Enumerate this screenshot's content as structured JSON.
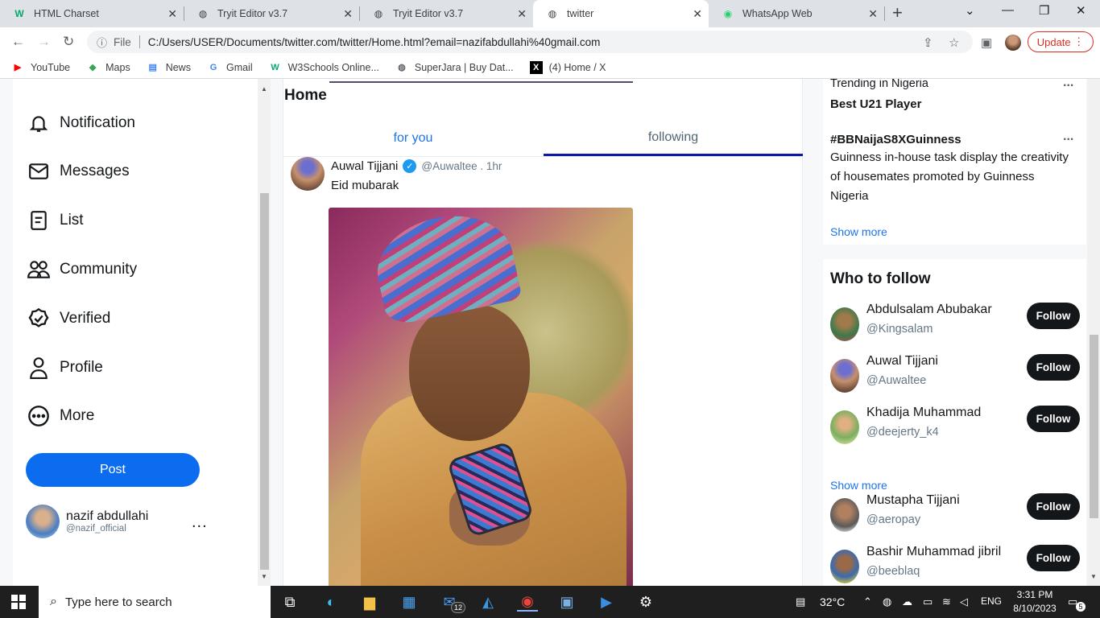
{
  "browser": {
    "tabs": [
      {
        "label": "HTML Charset",
        "icon": "w3schools-icon"
      },
      {
        "label": "Tryit Editor v3.7",
        "icon": "globe-icon"
      },
      {
        "label": "Tryit Editor v3.7",
        "icon": "globe-icon"
      },
      {
        "label": "twitter",
        "icon": "globe-icon",
        "active": true
      },
      {
        "label": "WhatsApp Web",
        "icon": "whatsapp-icon"
      }
    ],
    "address": {
      "scheme_label": "File",
      "url": "C:/Users/USER/Documents/twitter.com/twitter/Home.html?email=nazifabdullahi%40gmail.com"
    },
    "update_label": "Update",
    "bookmarks": [
      {
        "label": "YouTube",
        "icon": "youtube-icon",
        "color": "#ff0000"
      },
      {
        "label": "Maps",
        "icon": "maps-icon",
        "color": "#34a853"
      },
      {
        "label": "News",
        "icon": "news-icon",
        "color": "#4285f4"
      },
      {
        "label": "Gmail",
        "icon": "google-icon",
        "color": "#4285f4"
      },
      {
        "label": "W3Schools Online...",
        "icon": "w3schools-icon",
        "color": "#04aa6d"
      },
      {
        "label": "SuperJara | Buy Dat...",
        "icon": "globe-icon",
        "color": "#5f6368"
      },
      {
        "label": "(4) Home / X",
        "icon": "x-icon",
        "color": "#000000"
      }
    ]
  },
  "sidebar": {
    "items": [
      {
        "label": "Notification",
        "icon": "bell-icon"
      },
      {
        "label": "Messages",
        "icon": "mail-icon"
      },
      {
        "label": "List",
        "icon": "list-icon"
      },
      {
        "label": "Community",
        "icon": "community-icon"
      },
      {
        "label": "Verified",
        "icon": "verified-badge-icon"
      },
      {
        "label": "Profile",
        "icon": "user-icon"
      },
      {
        "label": "More",
        "icon": "more-circle-icon"
      }
    ],
    "post_label": "Post",
    "account": {
      "name": "nazif abdullahi",
      "handle": "@nazif_official",
      "menu": "..."
    }
  },
  "feed": {
    "title": "Home",
    "tabs": [
      {
        "label": "for you",
        "active": false
      },
      {
        "label": "following",
        "active": true
      }
    ],
    "tweet": {
      "author": "Auwal Tijjani",
      "handle_time": "@Auwaltee . 1hr",
      "text": "Eid mubarak"
    }
  },
  "trends": {
    "items": [
      {
        "meta": "Trending in Nigeria",
        "title": "Best U21 Player"
      },
      {
        "title": "#BBNaijaS8XGuinness",
        "description": "Guinness in-house task display the creativity of housemates promoted by Guinness Nigeria"
      }
    ],
    "menu": "...",
    "show_more": "Show more"
  },
  "who_to_follow": {
    "title": "Who to follow",
    "follow_label": "Follow",
    "show_more": "Show more",
    "accounts": [
      {
        "name": "Abdulsalam Abubakar",
        "handle": "@Kingsalam"
      },
      {
        "name": "Auwal Tijjani",
        "handle": "@Auwaltee"
      },
      {
        "name": "Khadija Muhammad",
        "handle": "@deejerty_k4"
      },
      {
        "name": "Mustapha Tijjani",
        "handle": "@aeropay"
      },
      {
        "name": "Bashir Muhammad jibril",
        "handle": "@beeblaq"
      }
    ]
  },
  "taskbar": {
    "search_placeholder": "Type here to search",
    "mail_badge": "12",
    "weather": "32°C",
    "language": "ENG",
    "time": "3:31 PM",
    "date": "8/10/2023",
    "notifications": "5"
  },
  "colors": {
    "accent": "#0b6cf0",
    "link": "#1d74e8",
    "follow_button": "#14171a"
  }
}
